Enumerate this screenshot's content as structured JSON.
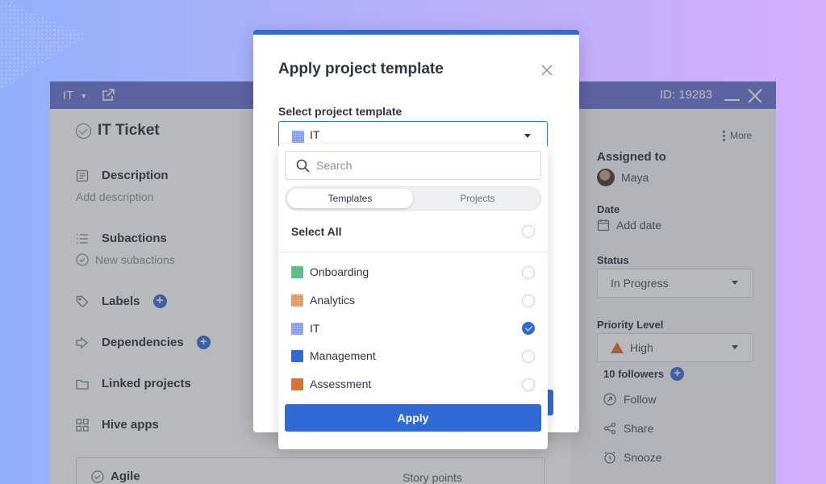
{
  "background_window": {
    "titlebar": {
      "project": "IT",
      "id_label": "ID: 19283"
    },
    "ticket": {
      "title": "IT Ticket"
    },
    "sections": {
      "description": {
        "label": "Description",
        "placeholder": "Add description"
      },
      "subactions": {
        "label": "Subactions",
        "placeholder": "New subactions"
      },
      "labels": {
        "label": "Labels"
      },
      "dependencies": {
        "label": "Dependencies"
      },
      "linked_projects": {
        "label": "Linked projects"
      },
      "hive_apps": {
        "label": "Hive apps"
      }
    },
    "agile": {
      "label": "Agile",
      "story_points": "Story points"
    },
    "right_panel": {
      "more": "More",
      "assigned_to": {
        "label": "Assigned to",
        "value": "Maya"
      },
      "date": {
        "label": "Date",
        "value": "Add date"
      },
      "status": {
        "label": "Status",
        "value": "In Progress"
      },
      "priority": {
        "label": "Priority Level",
        "value": "High"
      },
      "followers": "10 followers",
      "actions": {
        "follow": "Follow",
        "share": "Share",
        "snooze": "Snooze"
      }
    }
  },
  "modal": {
    "title": "Apply project template",
    "field_label": "Select project template",
    "selected_value": "IT",
    "dropdown": {
      "search_placeholder": "Search",
      "tabs": {
        "active": "Templates",
        "inactive": "Projects"
      },
      "select_all": "Select All",
      "options": [
        {
          "label": "Onboarding",
          "color": "#5bbf8d",
          "checked": false
        },
        {
          "label": "Analytics",
          "color": "#e2823c",
          "checked": false
        },
        {
          "label": "IT",
          "color": "#6f8de6",
          "checked": true
        },
        {
          "label": "Management",
          "color": "#2f6ad7",
          "checked": false
        },
        {
          "label": "Assessment",
          "color": "#e07032",
          "checked": false
        }
      ],
      "apply_label": "Apply"
    }
  },
  "colors": {
    "accent": "#2f6ad7",
    "titlebar": "#6b75d4"
  }
}
